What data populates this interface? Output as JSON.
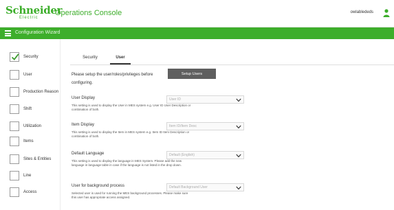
{
  "header": {
    "logo_line1": "Schneider",
    "logo_line2": "Electric",
    "app_title": "Operations Console",
    "username": "owlablededs"
  },
  "banner": {
    "title": "Configuration Wizard"
  },
  "sidebar": {
    "items": [
      {
        "label": "Security",
        "checked": true
      },
      {
        "label": "User",
        "checked": false
      },
      {
        "label": "Production Reason",
        "checked": false
      },
      {
        "label": "Shift",
        "checked": false
      },
      {
        "label": "Utilization",
        "checked": false
      },
      {
        "label": "Items",
        "checked": false
      },
      {
        "label": "Sites & Entities",
        "checked": false
      },
      {
        "label": "Line",
        "checked": false
      },
      {
        "label": "Access",
        "checked": false
      }
    ]
  },
  "main": {
    "tabs": [
      {
        "label": "Security",
        "active": false
      },
      {
        "label": "User",
        "active": true
      }
    ],
    "setup_text": "Please setup the user/roles/privileges before configuring.",
    "setup_button": "Setup Users",
    "settings": [
      {
        "title": "User Display",
        "description": "This setting is used to display the User in MES system e.g. User ID User Description or combination of both.",
        "value": "User ID"
      },
      {
        "title": "Item Display",
        "description": "This setting is used to display the Item in MES system e.g. Item ID Item Description or combination of both.",
        "value": "Item ID/Item Desc"
      },
      {
        "title": "Default Language",
        "description": "This setting is used to display the language in MES System. Please add the new language in language table in case if the language is not listed in the drop down.",
        "value": "Default (English)"
      },
      {
        "title": "User for background process",
        "description": "Selected user is used for running the MES background processes. Please make sure this user has appropriate access assigned.",
        "value": "Default Background User"
      }
    ]
  },
  "colors": {
    "brand_green": "#3dae2b",
    "button_gray": "#5f5f5f"
  }
}
